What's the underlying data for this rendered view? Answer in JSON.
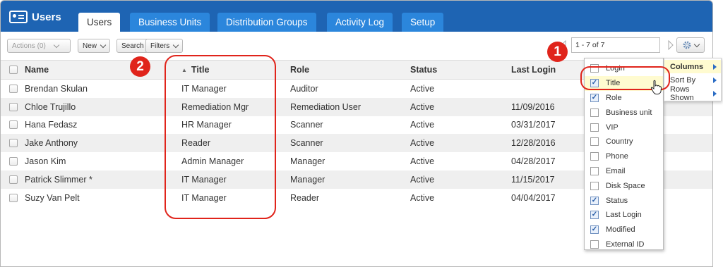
{
  "nav": {
    "app_title": "Users",
    "tabs": [
      {
        "label": "Users"
      },
      {
        "label": "Business Units"
      },
      {
        "label": "Distribution Groups"
      },
      {
        "label": "Activity Log"
      },
      {
        "label": "Setup"
      }
    ]
  },
  "toolbar": {
    "actions_label": "Actions (0)",
    "new_label": "New",
    "search_label": "Search",
    "filters_label": "Filters",
    "pager_text": "1 - 7 of 7"
  },
  "grid": {
    "columns": [
      "Name",
      "Title",
      "Role",
      "Status",
      "Last Login"
    ],
    "rows": [
      {
        "name": "Brendan Skulan",
        "title": "IT Manager",
        "role": "Auditor",
        "status": "Active",
        "last_login": ""
      },
      {
        "name": "Chloe Trujillo",
        "title": "Remediation Mgr",
        "role": "Remediation User",
        "status": "Active",
        "last_login": "11/09/2016"
      },
      {
        "name": "Hana Fedasz",
        "title": "HR Manager",
        "role": "Scanner",
        "status": "Active",
        "last_login": "03/31/2017"
      },
      {
        "name": "Jake Anthony",
        "title": "Reader",
        "role": "Scanner",
        "status": "Active",
        "last_login": "12/28/2016"
      },
      {
        "name": "Jason Kim",
        "title": "Admin Manager",
        "role": "Manager",
        "status": "Active",
        "last_login": "04/28/2017"
      },
      {
        "name": "Patrick Slimmer *",
        "title": "IT Manager",
        "role": "Manager",
        "status": "Active",
        "last_login": "11/15/2017"
      },
      {
        "name": "Suzy Van Pelt",
        "title": "IT Manager",
        "role": "Reader",
        "status": "Active",
        "last_login": "04/04/2017"
      }
    ]
  },
  "column_menu": {
    "items": [
      {
        "label": "Login",
        "checked": false
      },
      {
        "label": "Title",
        "checked": true
      },
      {
        "label": "Role",
        "checked": true
      },
      {
        "label": "Business unit",
        "checked": false
      },
      {
        "label": "VIP",
        "checked": false
      },
      {
        "label": "Country",
        "checked": false
      },
      {
        "label": "Phone",
        "checked": false
      },
      {
        "label": "Email",
        "checked": false
      },
      {
        "label": "Disk Space",
        "checked": false
      },
      {
        "label": "Status",
        "checked": true
      },
      {
        "label": "Last Login",
        "checked": true
      },
      {
        "label": "Modified",
        "checked": true
      },
      {
        "label": "External ID",
        "checked": false
      }
    ]
  },
  "settings_menu": {
    "items": [
      {
        "label": "Columns"
      },
      {
        "label": "Sort By"
      },
      {
        "label": "Rows Shown"
      }
    ]
  },
  "callouts": {
    "one": "1",
    "two": "2"
  },
  "colors": {
    "nav_bg": "#1e64b3",
    "tab_bg": "#2b86dc",
    "callout": "#e0241b",
    "row_alt": "#efefef"
  }
}
